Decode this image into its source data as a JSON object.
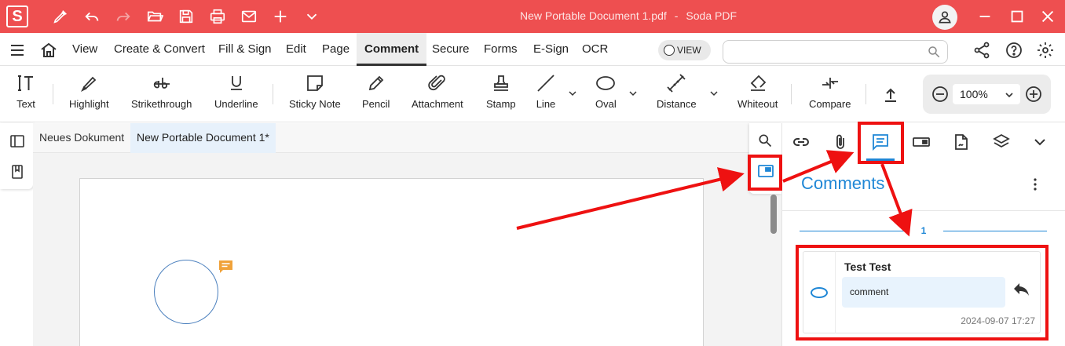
{
  "titlebar": {
    "logo_letter": "S",
    "doc_name": "New Portable Document 1.pdf",
    "separator": "-",
    "app_name": "Soda PDF"
  },
  "menu": {
    "items": [
      "View",
      "Create & Convert",
      "Fill & Sign",
      "Edit",
      "Page",
      "Comment",
      "Secure",
      "Forms",
      "E-Sign",
      "OCR"
    ],
    "active": "Comment",
    "view_toggle": "VIEW",
    "search_placeholder": ""
  },
  "toolbar": {
    "tools": [
      "Text",
      "Highlight",
      "Strikethrough",
      "Underline",
      "Sticky Note",
      "Pencil",
      "Attachment",
      "Stamp",
      "Line",
      "Oval",
      "Distance",
      "Whiteout",
      "Compare"
    ],
    "zoom": "100%"
  },
  "doc_tabs": [
    "Neues Dokument",
    "New Portable Document 1*"
  ],
  "panel": {
    "title": "Comments",
    "page_number": "1",
    "comment": {
      "author": "Test Test",
      "text": "comment",
      "timestamp": "2024-09-07 17:27"
    }
  },
  "colors": {
    "brand_red": "#ee4f50",
    "accent_blue": "#1f87d6",
    "annotation_red": "#ee1111",
    "note_orange": "#f0a23a"
  }
}
